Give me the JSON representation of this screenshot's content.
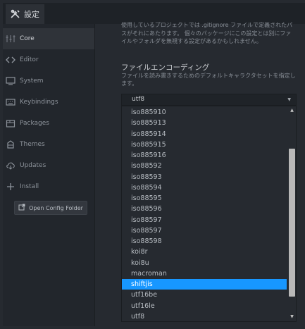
{
  "tab": {
    "label": "設定"
  },
  "sidebar": {
    "items": [
      {
        "label": "Core",
        "icon": "settings-sliders-icon",
        "active": true
      },
      {
        "label": "Editor",
        "icon": "code-icon"
      },
      {
        "label": "System",
        "icon": "monitor-icon"
      },
      {
        "label": "Keybindings",
        "icon": "keyboard-icon"
      },
      {
        "label": "Packages",
        "icon": "package-icon"
      },
      {
        "label": "Themes",
        "icon": "paintcan-icon"
      },
      {
        "label": "Updates",
        "icon": "cloud-download-icon"
      },
      {
        "label": "Install",
        "icon": "plus-icon"
      }
    ],
    "open_config_label": "Open Config Folder"
  },
  "main": {
    "top_description": "使用しているプロジェクトでは .gitignore ファイルで定義されたパスがそれにあたります。 個々のパッケージにこの設定とは別にファイルやフォルダを無視する設定があるかもしれません。",
    "setting": {
      "title": "ファイルエンコーディング",
      "description": "ファイルを読み書きするためのデフォルトキャラクタセットを指定します。",
      "value": "utf8"
    },
    "dropdown": {
      "options": [
        "iso885910",
        "iso885913",
        "iso885914",
        "iso885915",
        "iso885916",
        "iso88592",
        "iso88593",
        "iso88594",
        "iso88595",
        "iso88596",
        "iso88597",
        "iso88597",
        "iso88598",
        "koi8r",
        "koi8u",
        "macroman",
        "shiftjis",
        "utf16be",
        "utf16le",
        "utf8"
      ],
      "selected": "shiftjis"
    }
  },
  "colors": {
    "accent": "#1797ff",
    "background": "#262a30",
    "sidebar": "#22262c"
  }
}
